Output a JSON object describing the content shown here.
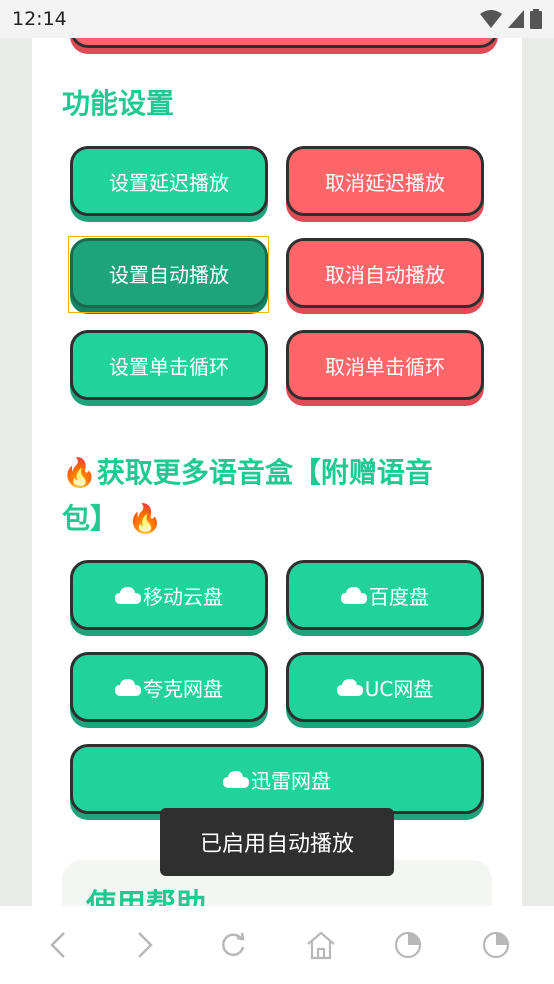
{
  "status_bar": {
    "time": "12:14"
  },
  "section1": {
    "title": "功能设置"
  },
  "buttons_settings": [
    {
      "label": "设置延迟播放"
    },
    {
      "label": "取消延迟播放"
    },
    {
      "label": "设置自动播放"
    },
    {
      "label": "取消自动播放"
    },
    {
      "label": "设置单击循环"
    },
    {
      "label": "取消单击循环"
    }
  ],
  "section2": {
    "title_line1": "🔥获取更多语音盒【附赠语音",
    "title_line2": "包】",
    "title_emoji_end": "🔥"
  },
  "cloud_buttons": [
    {
      "label": "移动云盘"
    },
    {
      "label": "百度盘"
    },
    {
      "label": "夸克网盘"
    },
    {
      "label": "UC网盘"
    },
    {
      "label": "迅雷网盘"
    }
  ],
  "toast": {
    "text": "已启用自动播放"
  },
  "help": {
    "title": "使用帮助"
  },
  "colors": {
    "green": "#21d29a",
    "red": "#ff6569",
    "title_green": "#21c992",
    "toast_bg": "#2f2f2f"
  },
  "nav_icons": [
    "back-icon",
    "forward-icon",
    "refresh-icon",
    "home-icon",
    "tabs-icon",
    "menu-icon"
  ]
}
